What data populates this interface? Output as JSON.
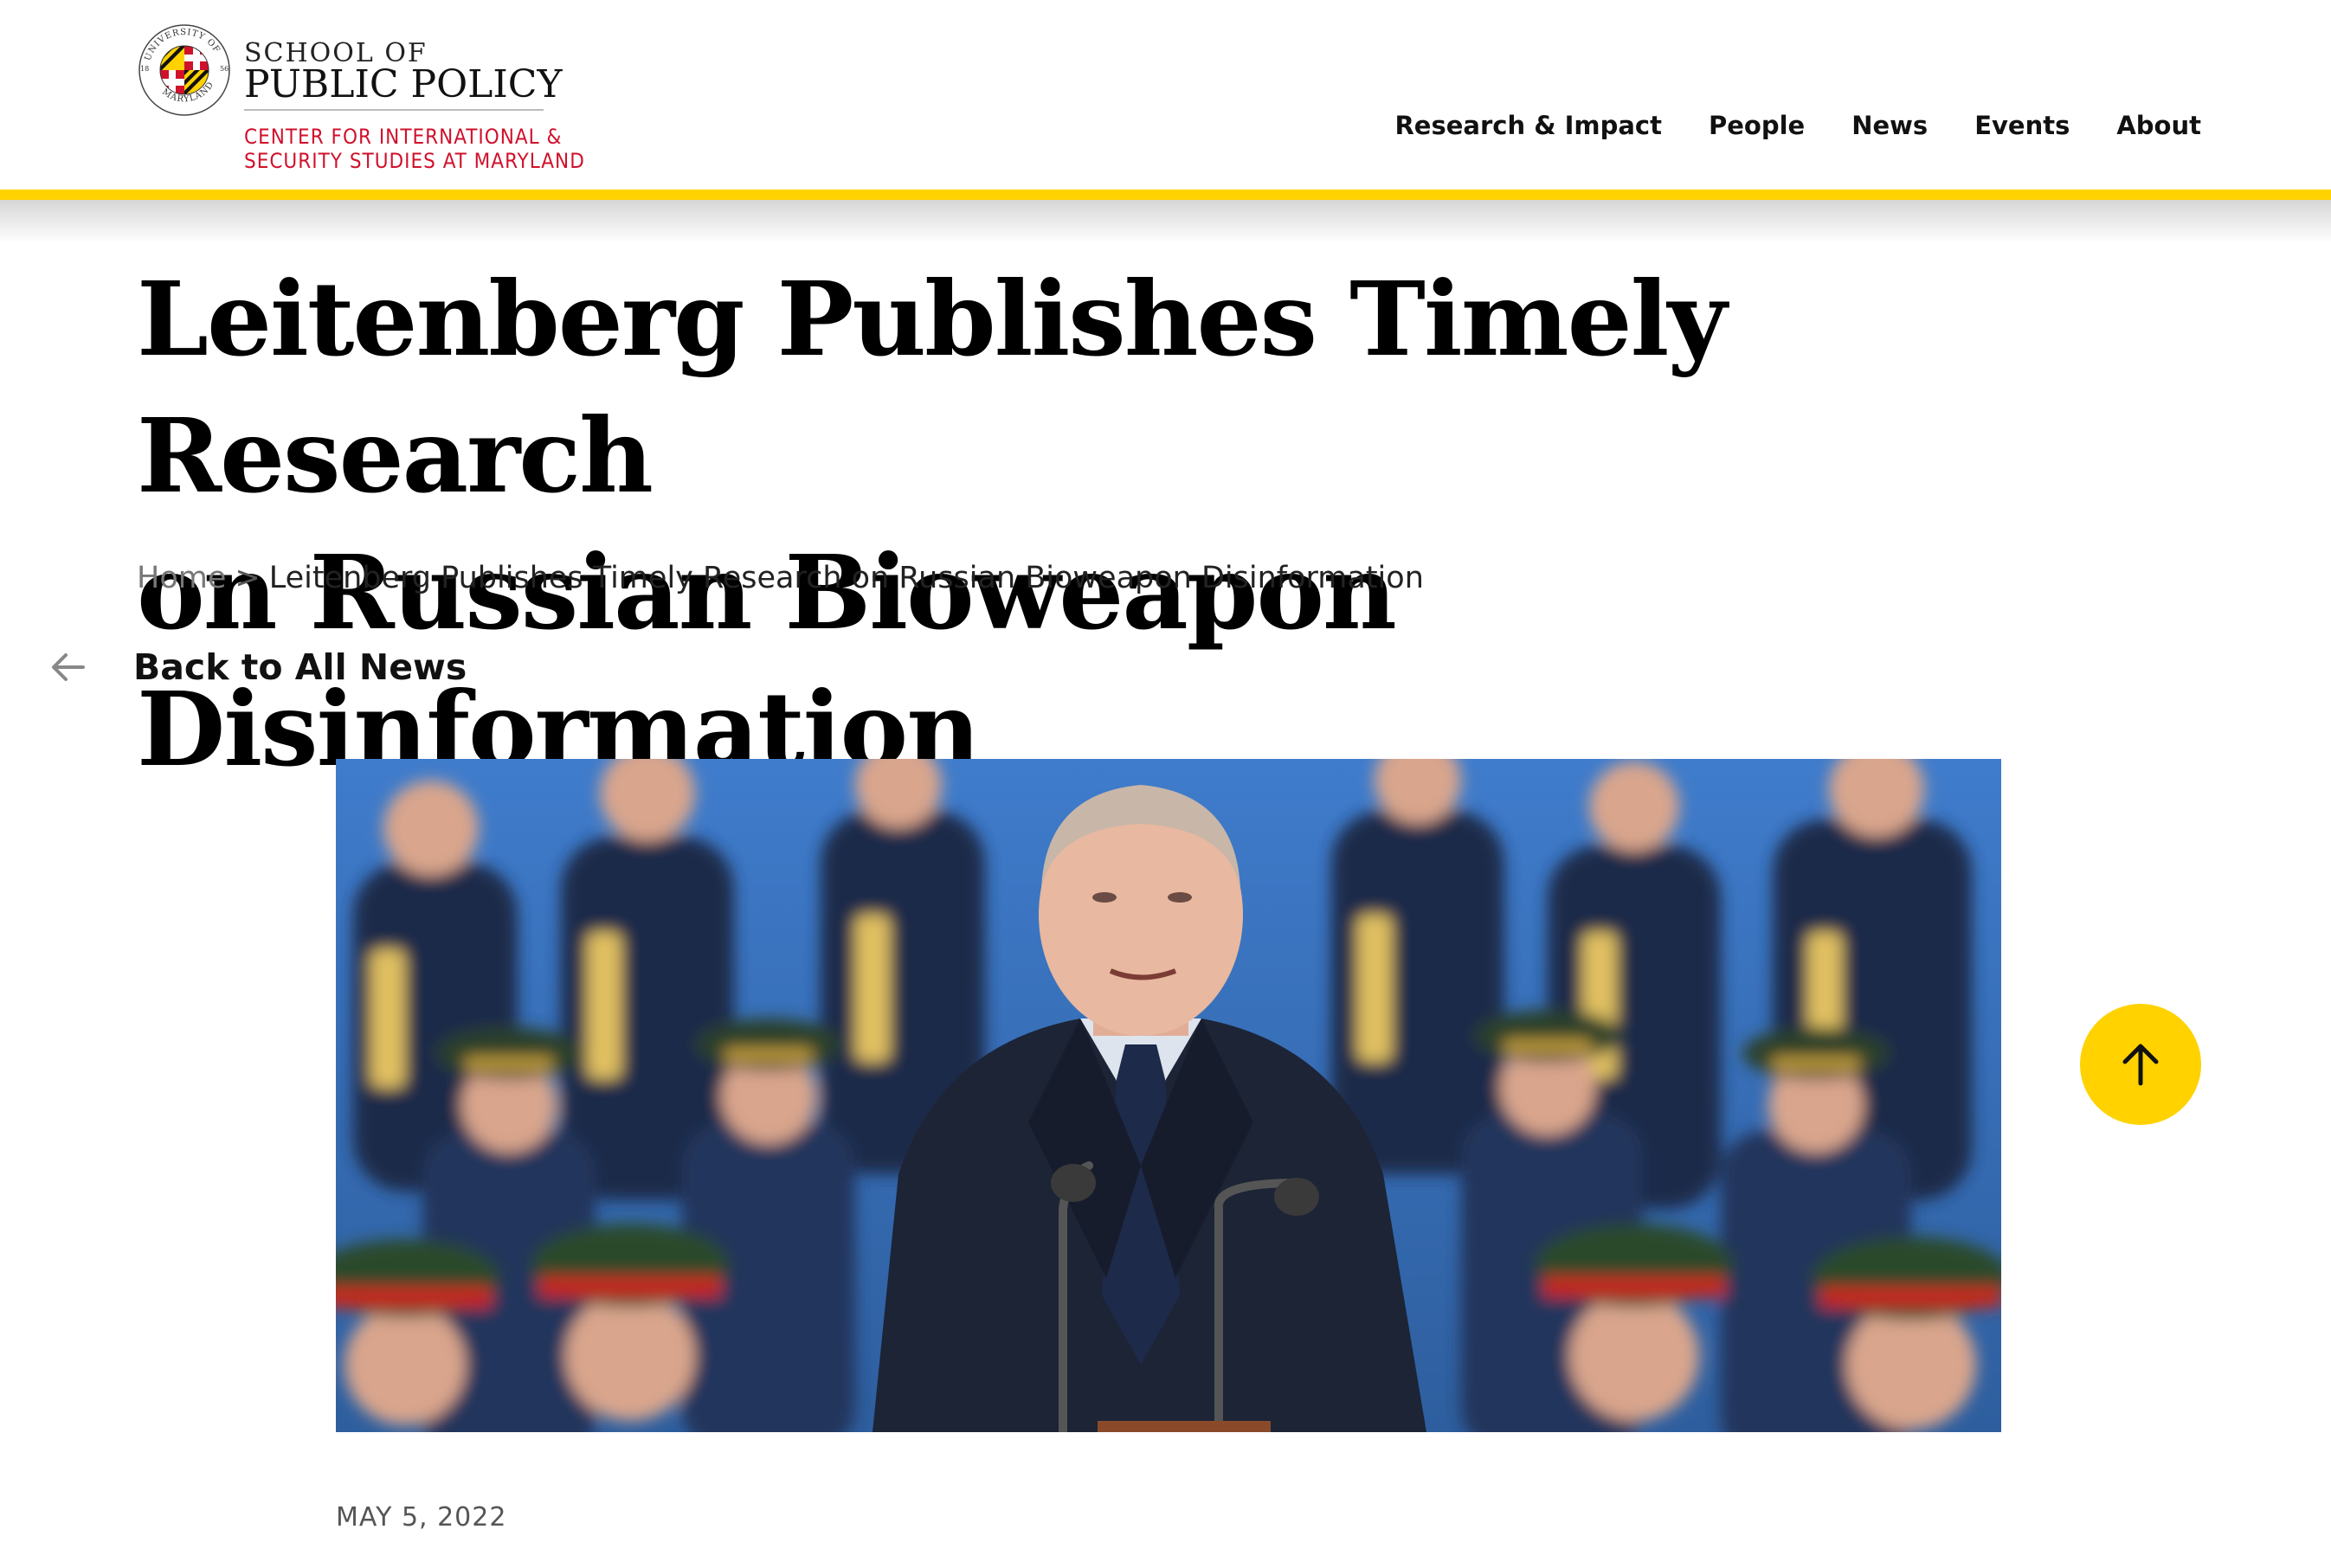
{
  "header": {
    "logo": {
      "seal_text_top": "UNIVERSITY OF",
      "seal_text_bottom": "MARYLAND",
      "seal_year_left": "18",
      "seal_year_right": "56",
      "school_of": "SCHOOL OF",
      "public_policy": "PUBLIC POLICY",
      "center_line1": "CENTER FOR INTERNATIONAL &",
      "center_line2": "SECURITY STUDIES AT MARYLAND"
    },
    "nav": [
      {
        "label": "Research & Impact"
      },
      {
        "label": "People"
      },
      {
        "label": "News"
      },
      {
        "label": "Events"
      },
      {
        "label": "About"
      }
    ],
    "accent_color": "#FFD200"
  },
  "article": {
    "title_line1": "Leitenberg Publishes Timely Research",
    "title_line2": "on Russian Bioweapon Disinformation",
    "breadcrumb": {
      "home": "Home",
      "separator": ">",
      "current": "Leitenberg Publishes Timely Research on Russian Bioweapon Disinformation"
    },
    "back_label": "Back to All News",
    "date": "MAY 5, 2022"
  },
  "icons": {
    "back": "arrow-left-icon",
    "scroll_top": "arrow-up-icon"
  }
}
